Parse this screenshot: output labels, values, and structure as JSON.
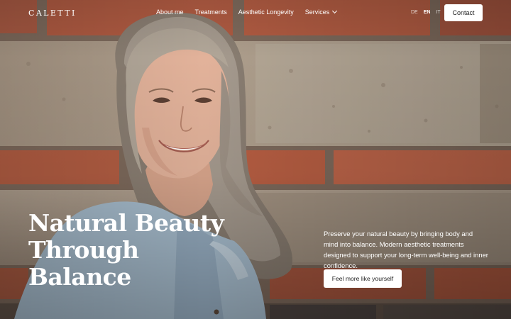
{
  "brand": {
    "logo": "CALETTI"
  },
  "nav": {
    "items": [
      {
        "label": "About me"
      },
      {
        "label": "Treatments"
      },
      {
        "label": "Aesthetic Longevity"
      },
      {
        "label": "Services"
      }
    ],
    "languages": [
      {
        "label": "DE",
        "active": false
      },
      {
        "label": "EN",
        "active": true
      },
      {
        "label": "IT",
        "active": false
      }
    ],
    "contact_label": "Contact"
  },
  "hero": {
    "headline_lines": [
      "Natural Beauty",
      "Through",
      "Balance"
    ],
    "description": "Preserve your natural beauty by bringing body and mind into balance. Modern aesthetic treatments designed to support your long-term well-being and inner confidence.",
    "cta_label": "Feel more like yourself",
    "image": "portrait-woman-smiling-brick-wall"
  },
  "colors": {
    "brick": "#b4573d",
    "stone": "#a9998a",
    "shirt": "#a9bfd0",
    "button_bg": "#ffffff",
    "button_text": "#1d1d1d"
  }
}
